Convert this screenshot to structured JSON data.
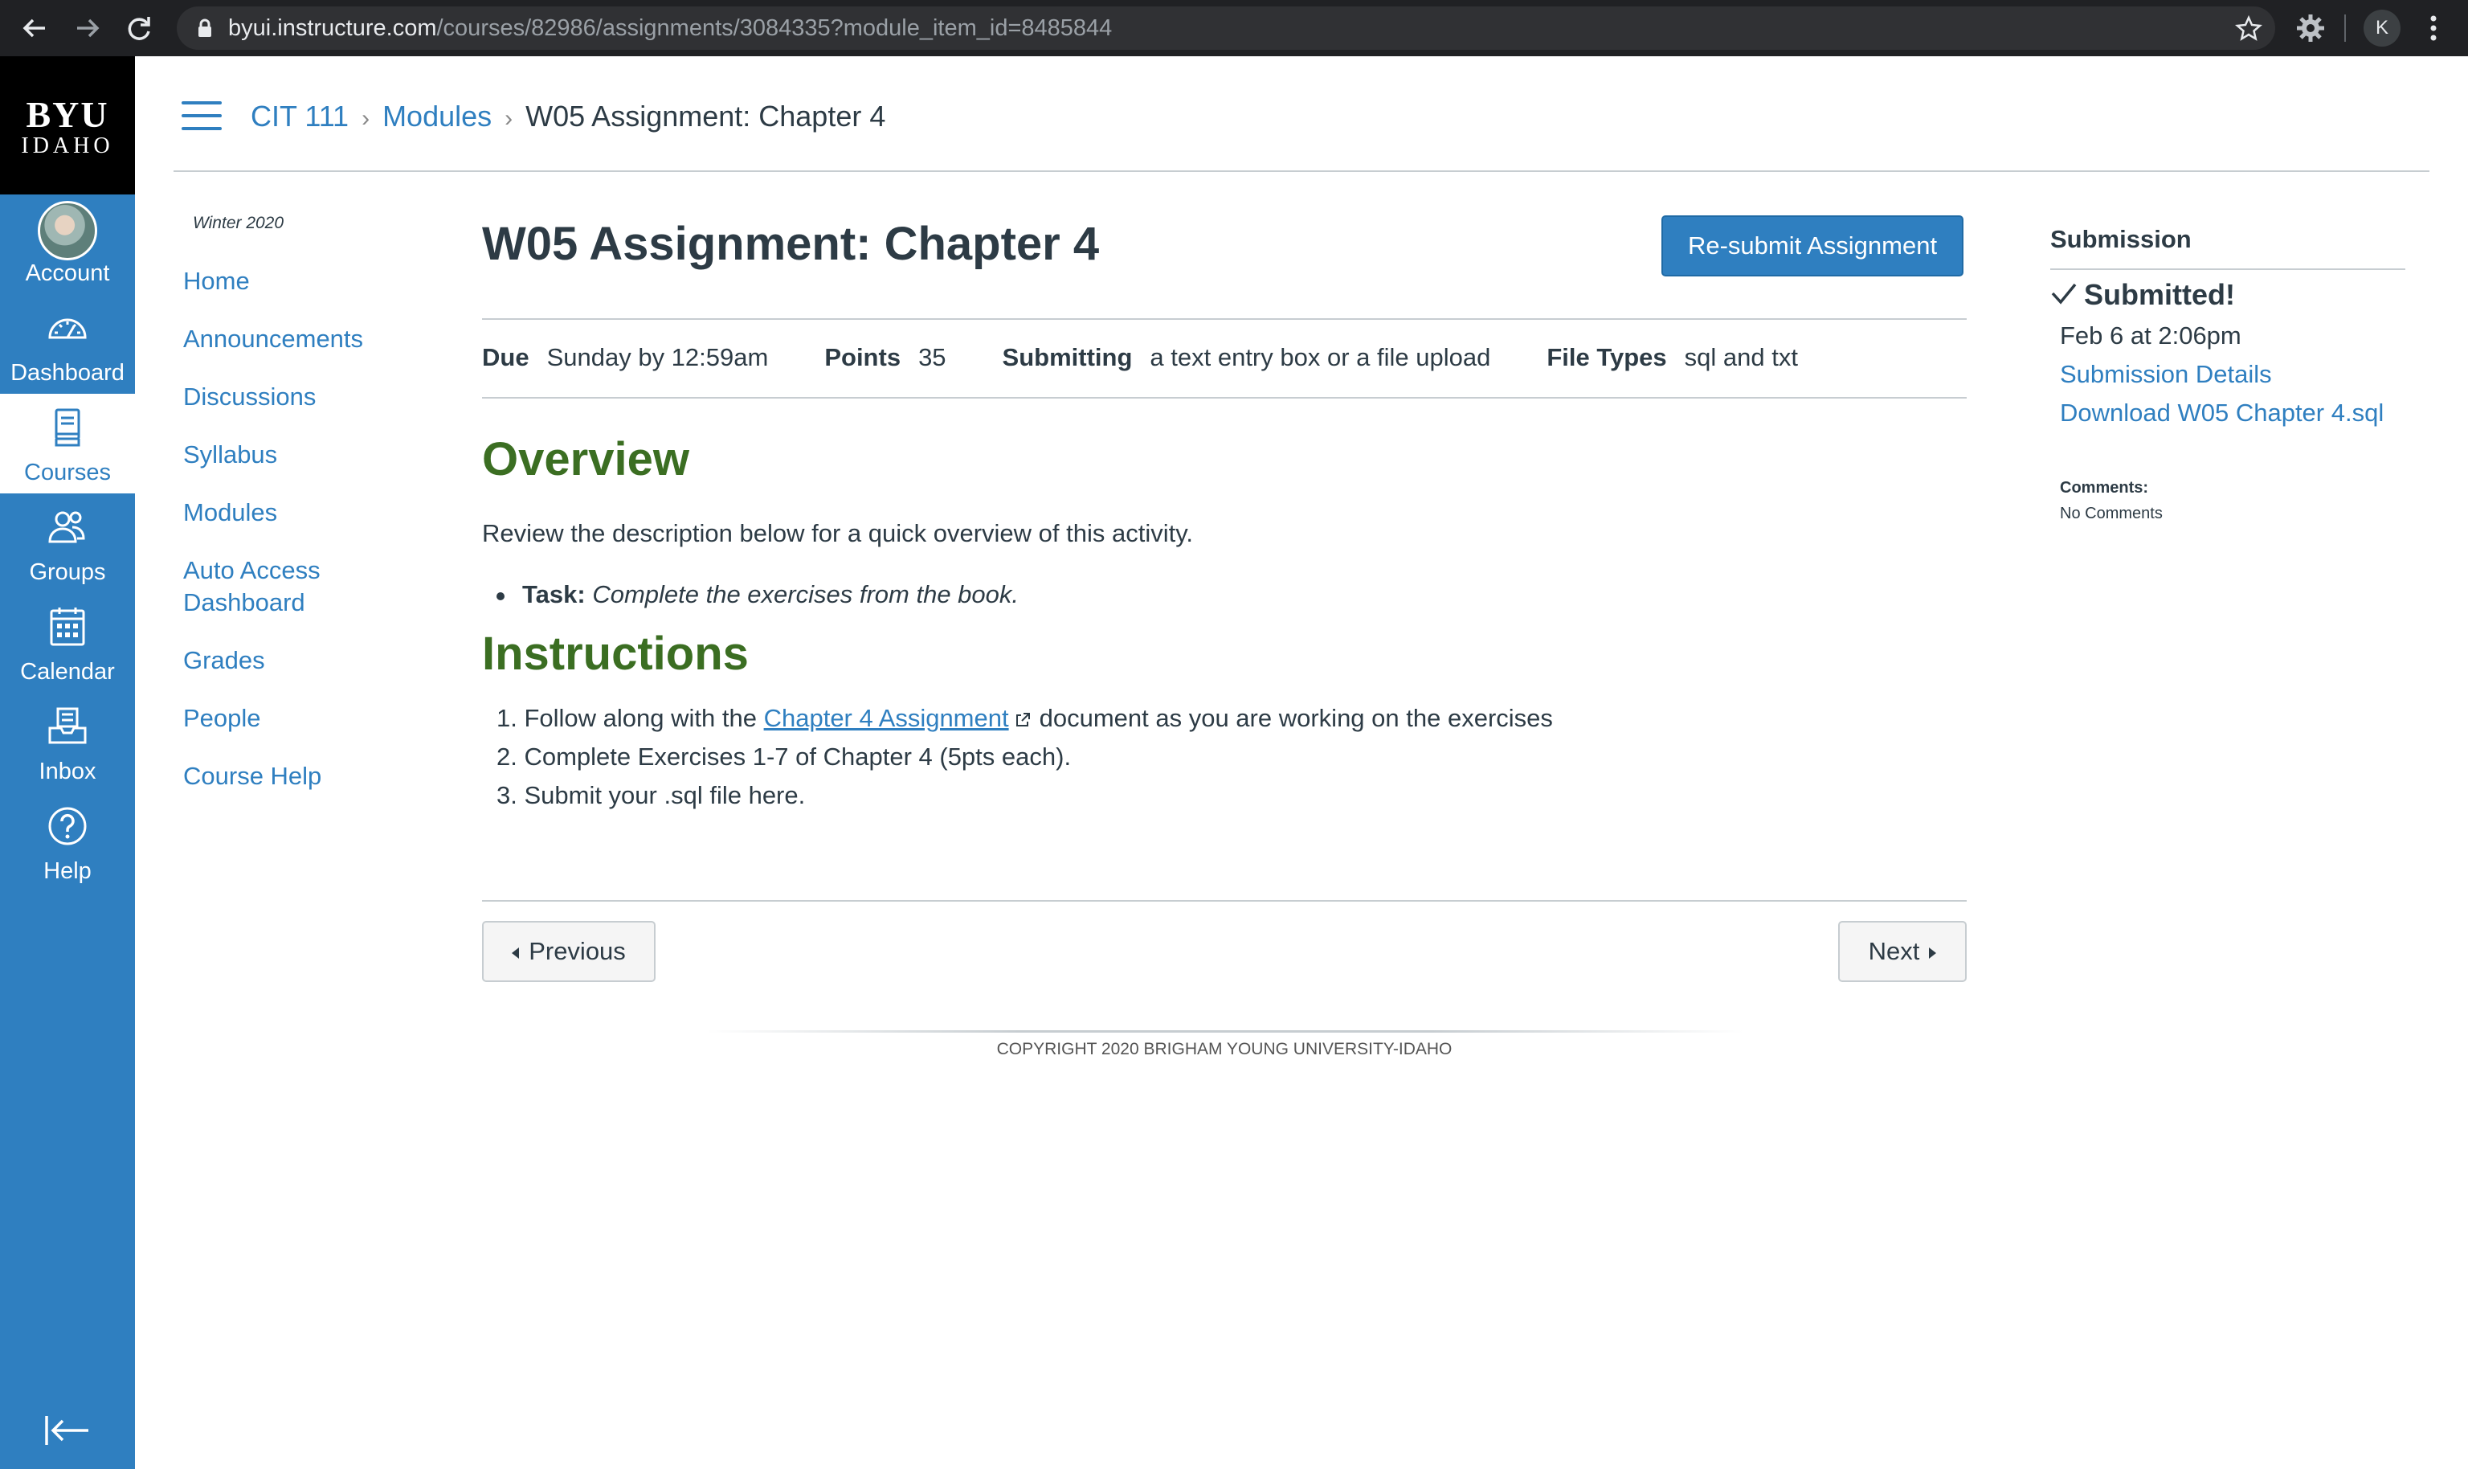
{
  "browser": {
    "url_host": "byui.instructure.com",
    "url_path": "/courses/82986/assignments/3084335?module_item_id=8485844",
    "profile_initial": "K"
  },
  "logo": {
    "line1": "BYU",
    "line2": "IDAHO"
  },
  "global_nav": {
    "items": [
      {
        "label": "Account",
        "icon": "avatar"
      },
      {
        "label": "Dashboard",
        "icon": "dashboard-icon"
      },
      {
        "label": "Courses",
        "icon": "courses-icon",
        "active": true
      },
      {
        "label": "Groups",
        "icon": "groups-icon"
      },
      {
        "label": "Calendar",
        "icon": "calendar-icon"
      },
      {
        "label": "Inbox",
        "icon": "inbox-icon"
      },
      {
        "label": "Help",
        "icon": "help-icon"
      }
    ]
  },
  "breadcrumb": {
    "course": "CIT 111",
    "modules": "Modules",
    "current": "W05 Assignment: Chapter 4"
  },
  "course_nav": {
    "term": "Winter 2020",
    "items": [
      "Home",
      "Announcements",
      "Discussions",
      "Syllabus",
      "Modules",
      "Auto Access Dashboard",
      "Grades",
      "People",
      "Course Help"
    ]
  },
  "assignment": {
    "title": "W05 Assignment: Chapter 4",
    "resubmit_label": "Re-submit Assignment",
    "due_label": "Due",
    "due_value": "Sunday by 12:59am",
    "points_label": "Points",
    "points_value": "35",
    "submitting_label": "Submitting",
    "submitting_value": "a text entry box or a file upload",
    "filetypes_label": "File Types",
    "filetypes_value": "sql and txt",
    "overview_heading": "Overview",
    "overview_text": "Review the description below for a quick overview of this activity.",
    "task_label": "Task:",
    "task_text": "Complete the exercises from the book.",
    "instructions_heading": "Instructions",
    "step1_pre": "1. Follow along with the",
    "step1_link": "Chapter 4 Assignment",
    "step1_post": "document as you are working on the exercises",
    "step2": "2. Complete Exercises 1-7 of Chapter 4 (5pts each).",
    "step3": "3. Submit your .sql file here.",
    "previous_label": "Previous",
    "next_label": "Next"
  },
  "footer": {
    "copyright": "COPYRIGHT 2020 BRIGHAM YOUNG UNIVERSITY-IDAHO"
  },
  "submission": {
    "heading": "Submission",
    "status": "Submitted!",
    "date": "Feb 6 at 2:06pm",
    "details_link": "Submission Details",
    "download_link": "Download W05 Chapter 4.sql",
    "comments_label": "Comments:",
    "comments_value": "No Comments"
  },
  "colors": {
    "brand_blue": "#2f7fc0",
    "heading_green": "#3b6e22",
    "text": "#2d3b45",
    "logo_bg": "#000000"
  }
}
